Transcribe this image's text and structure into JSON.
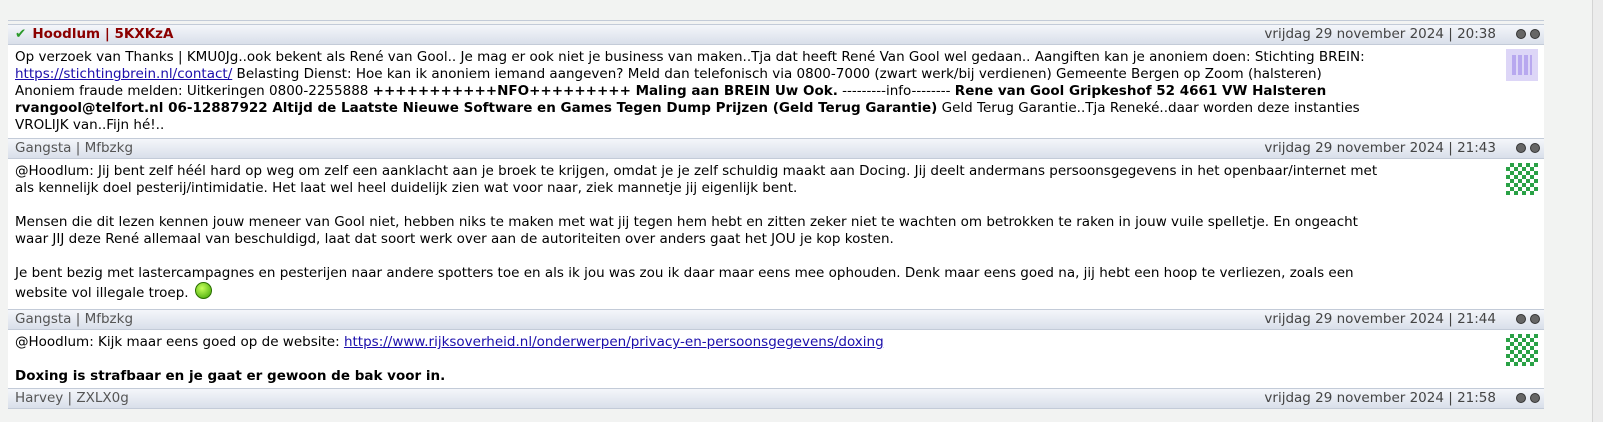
{
  "posts": [
    {
      "author": "Hoodlum | 5KXKzA",
      "date": "vrijdag 29 november 2024 | 20:38",
      "parts": [
        {
          "t": "Op verzoek van Thanks | KMU0Jg..ook bekent als René van Gool.. Je mag er ook niet je business van maken..Tja dat heeft René Van Gool wel gedaan.. Aangiften kan je anoniem doen: Stichting BREIN: "
        },
        {
          "t": "https://stichtingbrein.nl/contact/",
          "link": true
        },
        {
          "t": " Belasting Dienst: Hoe kan ik anoniem iemand aangeven? Meld dan telefonisch via 0800-7000 (zwart werk/bij verdienen) Gemeente Bergen op Zoom (halsteren) Anoniem fraude melden: Uitkeringen 0800-2255888 "
        },
        {
          "t": "+++++++++++NFO+++++++++ Maling aan BREIN Uw Ook.",
          "bold": true
        },
        {
          "t": " ---------info-------- "
        },
        {
          "t": "Rene van Gool Gripkeshof 52 4661 VW Halsteren rvangool@telfort.nl 06-12887922 Altijd de Laatste Nieuwe Software en Games Tegen Dump Prijzen (Geld Terug Garantie)",
          "bold": true
        },
        {
          "t": " Geld Terug Garantie..Tja Reneké..daar worden deze instanties VROLIJK van..Fijn hé!.."
        }
      ]
    },
    {
      "author": "Gangsta | Mfbzkg",
      "date": "vrijdag 29 november 2024 | 21:43",
      "paragraphs": [
        "@Hoodlum: Jij bent zelf héél hard op weg om zelf een aanklacht aan je broek te krijgen, omdat je je zelf schuldig maakt aan Docing. Jij deelt andermans persoonsgegevens in het openbaar/internet met als kennelijk doel pesterij/intimidatie. Het laat wel heel duidelijk zien wat voor naar, ziek mannetje jij eigenlijk bent.",
        "Mensen die dit lezen kennen jouw meneer van Gool niet, hebben niks te maken met wat jij tegen hem hebt en zitten zeker niet te wachten om betrokken te raken in jouw vuile spelletje. En ongeacht waar JIJ deze René allemaal van beschuldigd, laat dat soort werk over aan de autoriteiten over anders gaat het JOU je kop kosten.",
        "Je bent bezig met lastercampagnes en pesterijen naar andere spotters toe en als ik jou was zou ik daar maar eens mee ophouden. Denk maar eens goed na, jij hebt een hoop te verliezen, zoals een website vol illegale troep."
      ]
    },
    {
      "author": "Gangsta | Mfbzkg",
      "date": "vrijdag 29 november 2024 | 21:44",
      "prefix": "@Hoodlum: Kijk maar eens goed op de website: ",
      "link": "https://www.rijksoverheid.nl/onderwerpen/privacy-en-persoonsgegevens/doxing",
      "bold_line": "Doxing is strafbaar en je gaat er gewoon de bak voor in."
    },
    {
      "author": "Harvey | ZXLX0g",
      "date": "vrijdag 29 november 2024 | 21:58"
    }
  ]
}
